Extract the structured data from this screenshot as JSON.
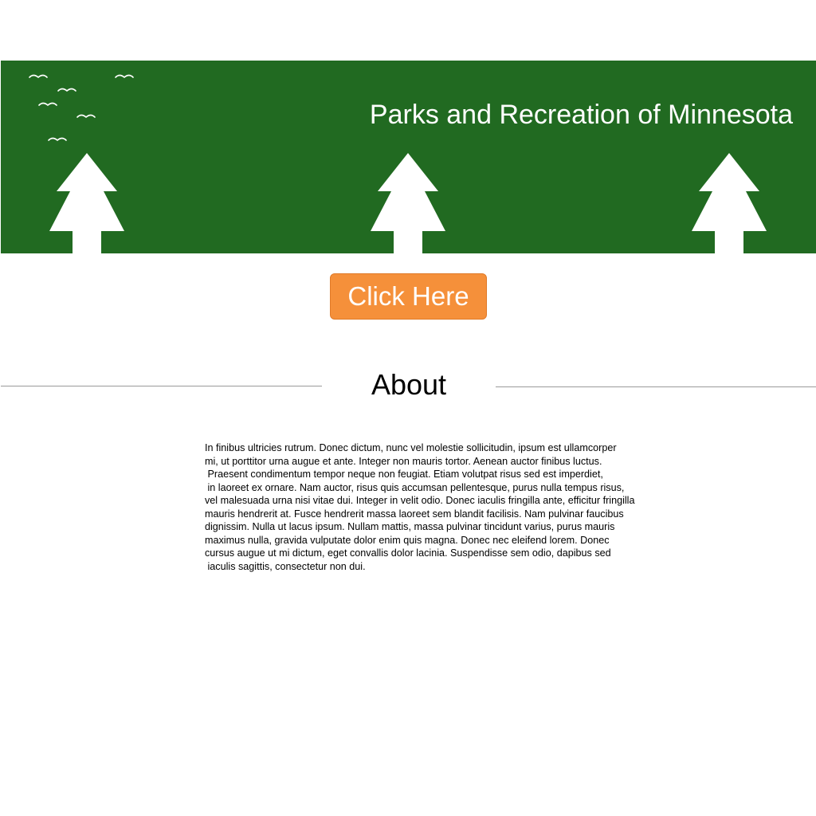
{
  "header": {
    "title": "Parks and Recreation of Minnesota",
    "background_color": "#216a21"
  },
  "cta": {
    "label": "Click Here",
    "color": "#f5903a"
  },
  "about": {
    "heading": "About",
    "lines": [
      "In finibus ultricies rutrum. Donec dictum, nunc vel molestie sollicitudin, ipsum est ullamcorper",
      "mi, ut porttitor urna augue et ante. Integer non mauris tortor. Aenean auctor finibus luctus.",
      " Praesent condimentum tempor neque non feugiat. Etiam volutpat risus sed est imperdiet,",
      " in laoreet ex ornare. Nam auctor, risus quis accumsan pellentesque, purus nulla tempus risus,",
      "vel malesuada urna nisi vitae dui. Integer in velit odio. Donec iaculis fringilla ante, efficitur fringilla",
      "mauris hendrerit at. Fusce hendrerit massa laoreet sem blandit facilisis. Nam pulvinar faucibus",
      "dignissim. Nulla ut lacus ipsum. Nullam mattis, massa pulvinar tincidunt varius, purus mauris",
      "maximus nulla, gravida vulputate dolor enim quis magna. Donec nec eleifend lorem. Donec",
      "cursus augue ut mi dictum, eget convallis dolor lacinia. Suspendisse sem odio, dapibus sed",
      " iaculis sagittis, consectetur non dui."
    ]
  },
  "icons": {
    "trees": [
      "tree-icon",
      "tree-icon",
      "tree-icon"
    ],
    "birds": [
      "bird-icon",
      "bird-icon",
      "bird-icon",
      "bird-icon",
      "bird-icon",
      "bird-icon"
    ]
  }
}
